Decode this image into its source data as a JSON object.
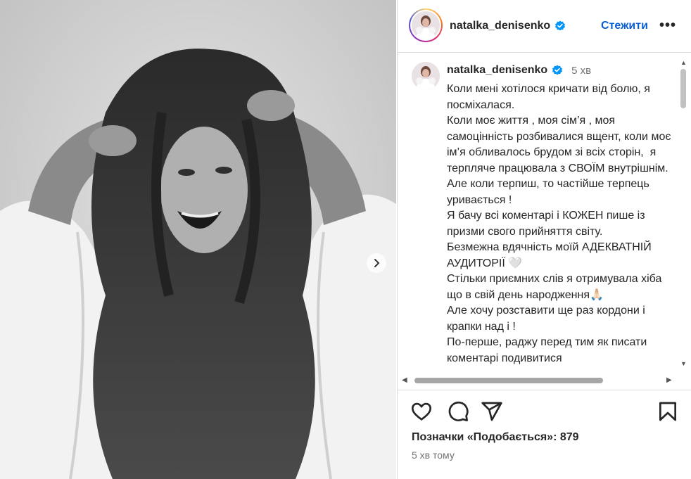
{
  "post": {
    "username": "natalka_denisenko",
    "follow_label": "Стежити",
    "more_label": "•••",
    "verified_color": "#0095f6"
  },
  "caption": {
    "username": "natalka_denisenko",
    "time": "5 хв",
    "text": "Коли мені хотілося кричати від болю, я посміхалася.\nКоли моє життя , моя сім’я , моя самоцінність розбивалися вщент, коли моє ім’я обливалось брудом зі всіх сторін,  я терпляче працювала з СВОЇМ внутрішнім.\nАле коли терпиш, то частійше терпець уривається !\nЯ бачу всі коментарі і КОЖЕН пише із призми свого прийняття світу.\nБезмежна вдячність моїй АДЕКВАТНІЙ АУДИТОРІЇ 🤍\nСтільки приємних слів я отримувала хіба що в свій день народження🙏🏻\nАле хочу розставити ще раз кордони і крапки над і !\nПо-перше, раджу перед тим як писати коментарі подивитися"
  },
  "actions": {
    "icons": [
      "heart-icon",
      "comment-icon",
      "share-icon",
      "bookmark-icon"
    ]
  },
  "stats": {
    "likes_label": "Позначки «Подобається»: 879",
    "posted": "5 хв тому"
  },
  "photo": {
    "style": "black-and-white portrait, woman in white shirt holding hair",
    "carousel_icon": "chevron-right-icon"
  }
}
